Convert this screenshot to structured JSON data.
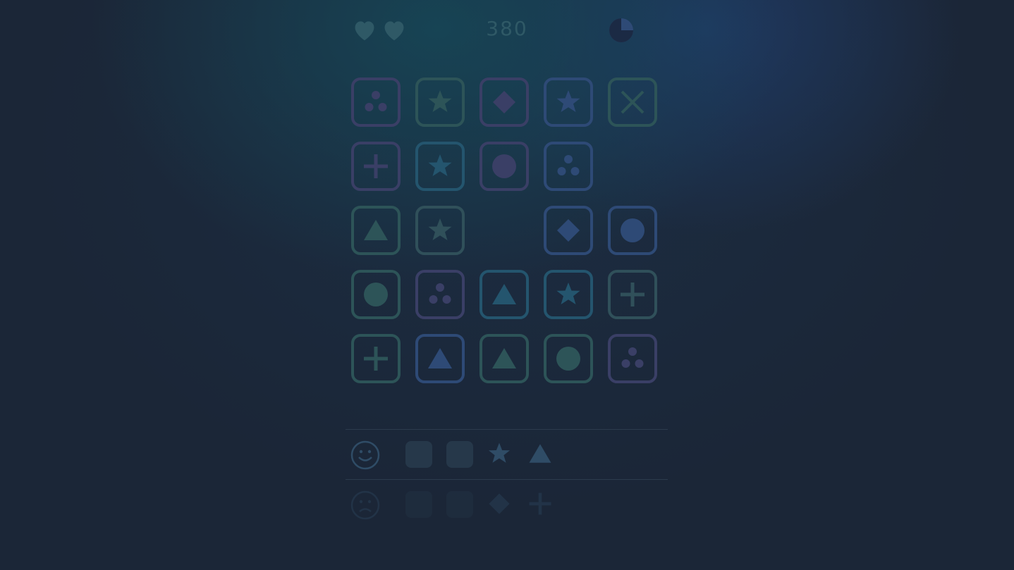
{
  "hud": {
    "lives": 2,
    "score": "380",
    "timer_progress": 0.25,
    "icons": [
      "heart-icon",
      "heart-icon",
      "timer-icon"
    ]
  },
  "board": {
    "rows": 5,
    "cols": 5,
    "tiles": [
      {
        "row": 0,
        "col": 0,
        "symbol": "dots",
        "color": "#3a3f66"
      },
      {
        "row": 0,
        "col": 1,
        "symbol": "star",
        "color": "#2d5458"
      },
      {
        "row": 0,
        "col": 2,
        "symbol": "diamond",
        "color": "#3a3f66"
      },
      {
        "row": 0,
        "col": 3,
        "symbol": "star",
        "color": "#2e4a76"
      },
      {
        "row": 0,
        "col": 4,
        "symbol": "cross",
        "color": "#2d5458"
      },
      {
        "row": 1,
        "col": 0,
        "symbol": "plus",
        "color": "#3a3f66"
      },
      {
        "row": 1,
        "col": 1,
        "symbol": "star",
        "color": "#24556e"
      },
      {
        "row": 1,
        "col": 2,
        "symbol": "circle",
        "color": "#3a3f66"
      },
      {
        "row": 1,
        "col": 3,
        "symbol": "dots",
        "color": "#2e4a76"
      },
      {
        "row": 2,
        "col": 0,
        "symbol": "triangle",
        "color": "#2d5458"
      },
      {
        "row": 2,
        "col": 1,
        "symbol": "star",
        "color": "#30505a"
      },
      {
        "row": 2,
        "col": 3,
        "symbol": "diamond",
        "color": "#2e4a76"
      },
      {
        "row": 2,
        "col": 4,
        "symbol": "circle",
        "color": "#2e4a76"
      },
      {
        "row": 3,
        "col": 0,
        "symbol": "circle",
        "color": "#2d5458"
      },
      {
        "row": 3,
        "col": 1,
        "symbol": "dots",
        "color": "#3a3f66"
      },
      {
        "row": 3,
        "col": 2,
        "symbol": "triangle",
        "color": "#24556e"
      },
      {
        "row": 3,
        "col": 3,
        "symbol": "star",
        "color": "#24556e"
      },
      {
        "row": 3,
        "col": 4,
        "symbol": "plus",
        "color": "#30505a"
      },
      {
        "row": 4,
        "col": 0,
        "symbol": "plus",
        "color": "#2d5458"
      },
      {
        "row": 4,
        "col": 1,
        "symbol": "triangle",
        "color": "#2e4a76"
      },
      {
        "row": 4,
        "col": 2,
        "symbol": "triangle",
        "color": "#2d5458"
      },
      {
        "row": 4,
        "col": 3,
        "symbol": "circle",
        "color": "#2d5458"
      },
      {
        "row": 4,
        "col": 4,
        "symbol": "dots",
        "color": "#3a3f66"
      }
    ]
  },
  "panel": {
    "rows": [
      {
        "face": "happy",
        "slots": 2,
        "symbols": [
          "star",
          "triangle"
        ]
      },
      {
        "face": "sad",
        "slots": 2,
        "symbols": [
          "diamond",
          "plus"
        ]
      }
    ]
  },
  "colors": {
    "background": "#1b2637",
    "hud": "#2f5966",
    "panel_symbol": "#2f4c66",
    "slot": "#26384a"
  }
}
